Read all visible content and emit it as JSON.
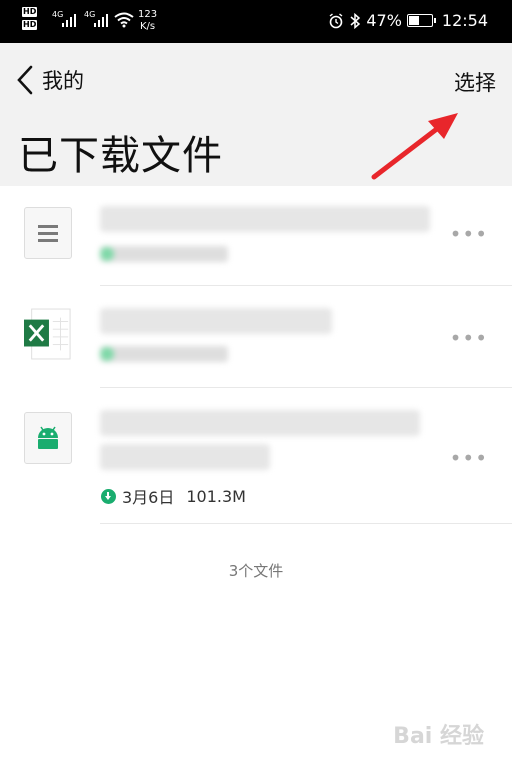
{
  "status_bar": {
    "left_badges": [
      "HD",
      "HD"
    ],
    "signal_1": "4G",
    "signal_2": "4G",
    "net_speed_value": "123",
    "net_speed_unit": "K/s",
    "battery": "47%",
    "battery_level": 0.47,
    "time": "12:54",
    "icons": [
      "alarm-icon",
      "bluetooth-icon",
      "battery-icon",
      "wifi-icon",
      "signal-icon"
    ]
  },
  "header": {
    "back_label": "我的",
    "select_label": "选择",
    "title": "已下载文件"
  },
  "files": [
    {
      "icon": "document-icon",
      "name_blurred": true,
      "meta_blurred": true
    },
    {
      "icon": "excel-icon",
      "name_blurred": true,
      "meta_blurred": true
    },
    {
      "icon": "android-apk-icon",
      "name_blurred": true,
      "date": "3月6日",
      "size": "101.3M"
    }
  ],
  "footer": {
    "count_text": "3个文件"
  },
  "annotation": {
    "arrow_color": "#e8262b"
  },
  "watermark": "Bai 经验"
}
